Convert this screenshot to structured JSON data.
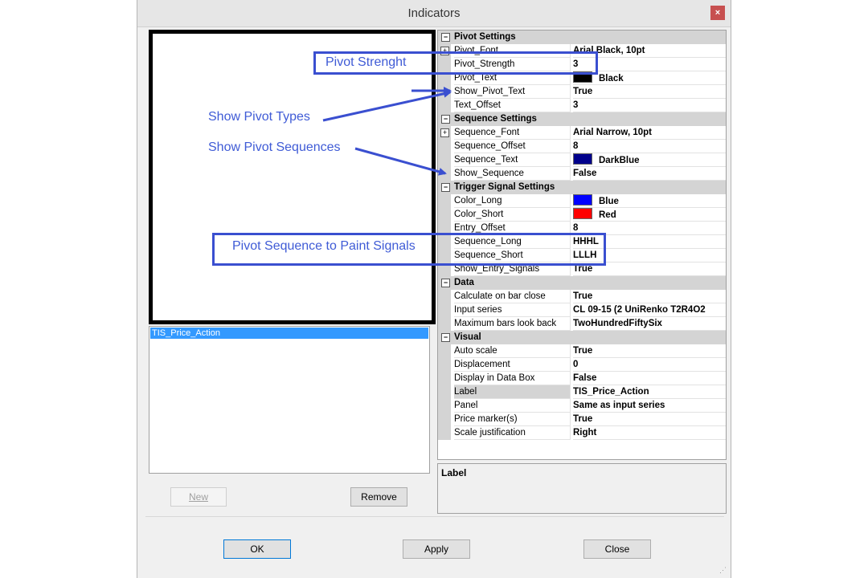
{
  "window": {
    "title": "Indicators",
    "close_glyph": "×"
  },
  "indicator_list": {
    "items": [
      "TIS_Price_Action"
    ]
  },
  "buttons": {
    "new": "New",
    "remove": "Remove",
    "ok": "OK",
    "apply": "Apply",
    "close": "Close"
  },
  "properties": {
    "pivot": {
      "title": "Pivot Settings",
      "rows": [
        {
          "name": "Pivot_Font",
          "value": "Arial Black, 10pt"
        },
        {
          "name": "Pivot_Strength",
          "value": "3"
        },
        {
          "name": "Pivot_Text",
          "value": "Black",
          "color": "#000000"
        },
        {
          "name": "Show_Pivot_Text",
          "value": "True"
        },
        {
          "name": "Text_Offset",
          "value": "3"
        }
      ]
    },
    "sequence": {
      "title": "Sequence Settings",
      "rows": [
        {
          "name": "Sequence_Font",
          "value": "Arial Narrow, 10pt"
        },
        {
          "name": "Sequence_Offset",
          "value": "8"
        },
        {
          "name": "Sequence_Text",
          "value": "DarkBlue",
          "color": "#00008b"
        },
        {
          "name": "Show_Sequence",
          "value": "False"
        }
      ]
    },
    "trigger": {
      "title": "Trigger Signal Settings",
      "rows": [
        {
          "name": "Color_Long",
          "value": "Blue",
          "color": "#0000ff"
        },
        {
          "name": "Color_Short",
          "value": "Red",
          "color": "#ff0000"
        },
        {
          "name": "Entry_Offset",
          "value": "8"
        },
        {
          "name": "Sequence_Long",
          "value": "HHHL"
        },
        {
          "name": "Sequence_Short",
          "value": "LLLH"
        },
        {
          "name": "Show_Entry_Signals",
          "value": "True"
        }
      ]
    },
    "data": {
      "title": "Data",
      "rows": [
        {
          "name": "Calculate on bar close",
          "value": "True"
        },
        {
          "name": "Input series",
          "value": "CL 09-15 (2 UniRenko T2R4O2"
        },
        {
          "name": "Maximum bars look back",
          "value": "TwoHundredFiftySix"
        }
      ]
    },
    "visual": {
      "title": "Visual",
      "rows": [
        {
          "name": "Auto scale",
          "value": "True"
        },
        {
          "name": "Displacement",
          "value": "0"
        },
        {
          "name": "Display in Data Box",
          "value": "False"
        },
        {
          "name": "Label",
          "value": "TIS_Price_Action"
        },
        {
          "name": "Panel",
          "value": "Same as input series"
        },
        {
          "name": "Price marker(s)",
          "value": "True"
        },
        {
          "name": "Scale justification",
          "value": "Right"
        }
      ]
    }
  },
  "help_panel": {
    "title": "Label"
  },
  "annotations": {
    "pivot_strength": "Pivot Strenght",
    "show_pivot_types": "Show Pivot Types",
    "show_pivot_sequences": "Show Pivot Sequences",
    "paint_signals": "Pivot Sequence to Paint Signals"
  },
  "colors": {
    "annotation": "#3a4fd0",
    "selection": "#3399ff",
    "close_button": "#c75050"
  }
}
